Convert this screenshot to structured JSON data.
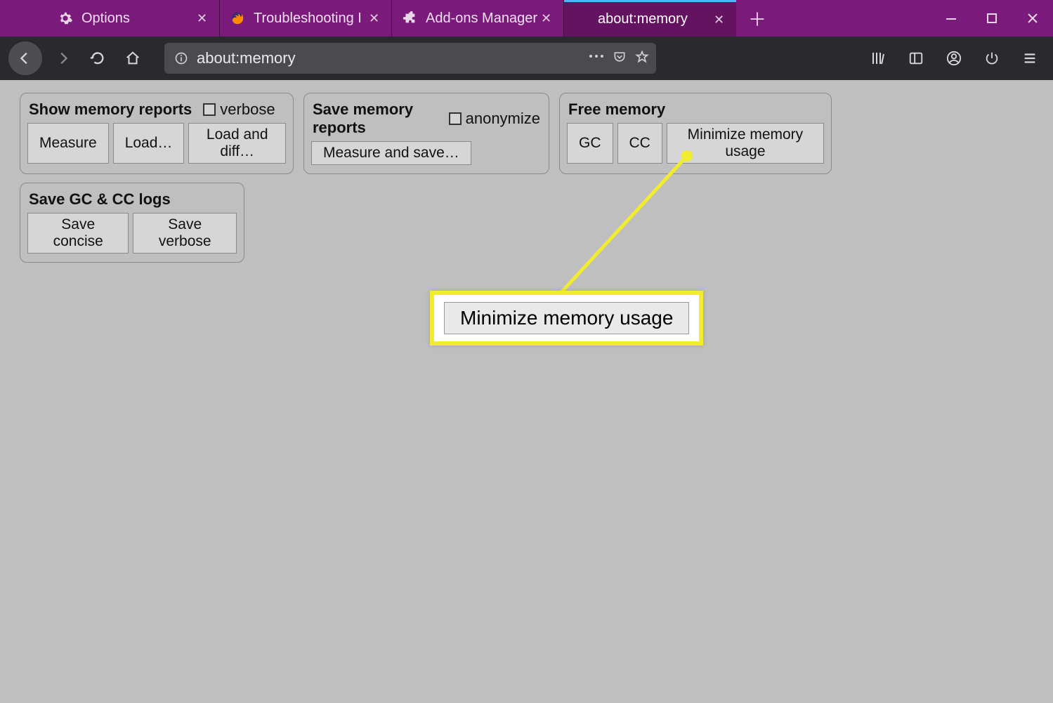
{
  "tabs": [
    {
      "label": "Options",
      "icon": "gear-icon"
    },
    {
      "label": "Troubleshooting I",
      "icon": "firefox-icon"
    },
    {
      "label": "Add-ons Manager",
      "icon": "puzzle-icon"
    },
    {
      "label": "about:memory",
      "icon": "",
      "active": true
    }
  ],
  "urlbar": {
    "text": "about:memory"
  },
  "panels": {
    "show": {
      "title": "Show memory reports",
      "checkbox": "verbose",
      "buttons": {
        "measure": "Measure",
        "load": "Load…",
        "load_diff": "Load and diff…"
      }
    },
    "save": {
      "title": "Save memory reports",
      "checkbox": "anonymize",
      "buttons": {
        "measure_save": "Measure and save…"
      }
    },
    "free": {
      "title": "Free memory",
      "buttons": {
        "gc": "GC",
        "cc": "CC",
        "minimize": "Minimize memory usage"
      }
    },
    "logs": {
      "title": "Save GC & CC logs",
      "buttons": {
        "concise": "Save concise",
        "verbose": "Save verbose"
      }
    }
  },
  "callout": {
    "label": "Minimize memory usage"
  }
}
